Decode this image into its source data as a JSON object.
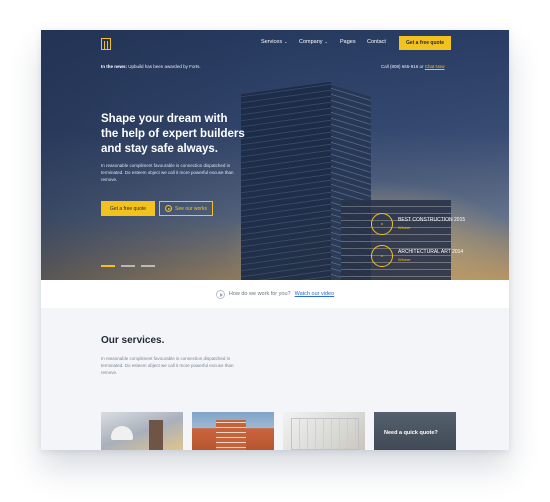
{
  "nav": {
    "logo": "building-logo",
    "items": [
      {
        "label": "Services",
        "dropdown": true
      },
      {
        "label": "Company",
        "dropdown": true
      },
      {
        "label": "Pages",
        "dropdown": false
      },
      {
        "label": "Contact",
        "dropdown": false
      }
    ],
    "cta_label": "Get a free quote"
  },
  "topbar": {
    "news_prefix": "In the news:",
    "news_text": "Upbuild has been awarded by Forts.",
    "call_text": "Call (808) 666-816 or",
    "chat_label": "Chat Now"
  },
  "hero": {
    "headline_lines": [
      "Shape your dream with",
      "the help of expert builders",
      "and stay safe always."
    ],
    "description": "In reasonable compliment favourable is connection dispatched in terminated. Do esteem object we call it more powerful excuse than remove.",
    "primary_label": "Get a free quote",
    "video_label": "See our works",
    "slides": [
      {
        "active": true
      },
      {
        "active": false
      },
      {
        "active": false
      }
    ],
    "awards": [
      {
        "title": "BEST CONSTRUCTION 2015",
        "subtitle": "Winner"
      },
      {
        "title": "ARCHITECTURAL ART 2014",
        "subtitle": "Winner"
      }
    ]
  },
  "work_bar": {
    "text": "How do we work for you?",
    "link": "Watch our video"
  },
  "services": {
    "title": "Our services.",
    "description": "In reasonable compliment favourable is connection dispatched in terminated. Do esteem object we call it more powerful excuse than remove.",
    "quote_card": "Need a quick quote?"
  },
  "colors": {
    "accent": "#f4c21f",
    "link": "#2a6bd8",
    "dark": "#222a36"
  }
}
